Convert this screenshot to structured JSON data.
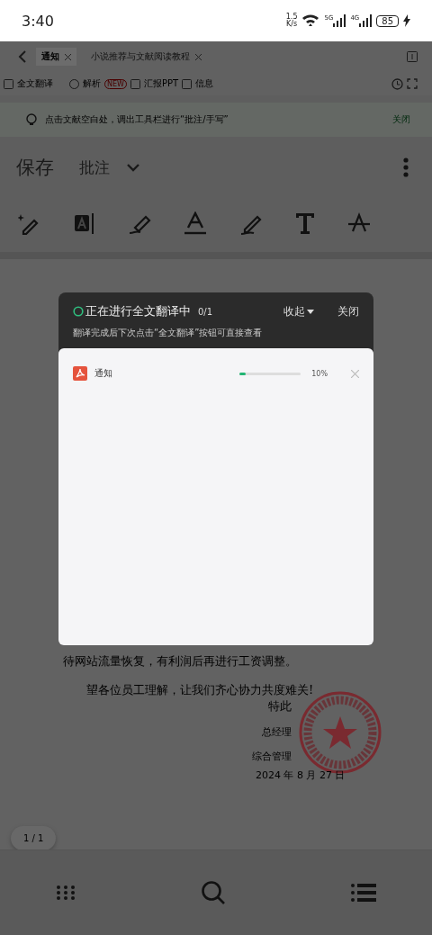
{
  "status_bar": {
    "time": "3:40",
    "speed": "1.5",
    "speed_unit": "K/s",
    "signals": [
      "5G",
      "4G"
    ],
    "battery": "85"
  },
  "tabs": [
    {
      "label": "通知",
      "selected": true
    },
    {
      "label": "小说推荐与文献阅读教程",
      "selected": false
    }
  ],
  "toolbar": [
    {
      "label": "全文翻译"
    },
    {
      "label": "解析",
      "badge": "NEW"
    },
    {
      "label": "汇报PPT"
    },
    {
      "label": "信息"
    }
  ],
  "tip": {
    "text": "点击文献空白处，调出工具栏进行“批注/手写”",
    "action": "关闭"
  },
  "edit_bar": {
    "save": "保存",
    "mode": "批注"
  },
  "document": {
    "lines": [
      "待网站流量恢复，有利润后再进行工资调整。",
      "望各位员工理解，让我们齐心协力共度难关!"
    ],
    "sign": [
      "特此",
      "总经理",
      "综合管理"
    ],
    "date": "2024 年 8 月 27 日"
  },
  "page_indicator": "1 / 1",
  "dialog": {
    "title": "正在进行全文翻译中",
    "count": "0/1",
    "collapse": "收起",
    "close": "关闭",
    "hint": "翻译完成后下次点击“全文翻译”按钮可直接查看",
    "files": [
      {
        "name": "通知",
        "level": 0.1,
        "reading": "10%"
      }
    ]
  }
}
